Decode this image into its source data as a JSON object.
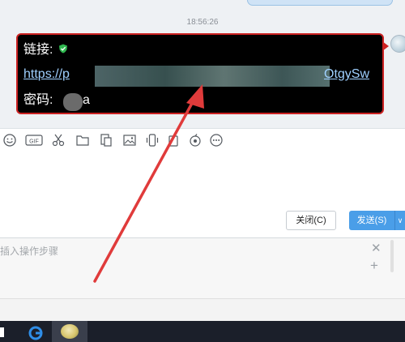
{
  "chat": {
    "timestamp": "18:56:26",
    "message": {
      "link_label": "链接:",
      "url_start": "https://p",
      "url_end": "OtgySw",
      "password_label": "密码:",
      "password_suffix": "a"
    }
  },
  "toolbar": {
    "icons": [
      "emoji-icon",
      "gif-icon",
      "scissors-icon",
      "folder-icon",
      "document-icon",
      "image-icon",
      "phone-shake-icon",
      "bookmark-icon",
      "poke-icon",
      "more-icon"
    ]
  },
  "actions": {
    "close_label": "关闭(C)",
    "send_label": "发送(S)",
    "send_dropdown_symbol": "∨"
  },
  "steps": {
    "placeholder": "插入操作步骤",
    "close_symbol": "✕",
    "add_symbol": "+"
  },
  "colors": {
    "bubble_bg": "#000000",
    "bubble_border": "#cc2222",
    "link": "#9fd0ff",
    "send_button": "#4a9ee8",
    "annotation_arrow": "#e03b3b",
    "taskbar": "#1b1f2a"
  }
}
